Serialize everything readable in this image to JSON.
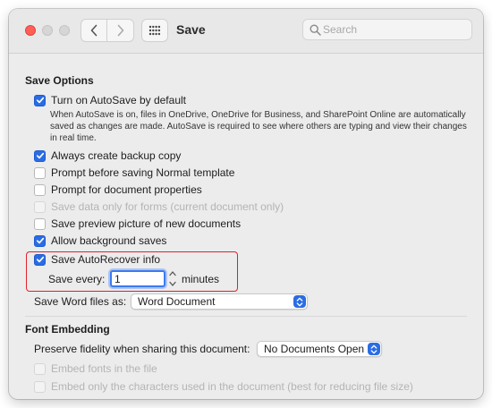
{
  "window": {
    "title": "Save",
    "search_placeholder": "Search"
  },
  "save_options": {
    "heading": "Save Options",
    "autosave": {
      "label": "Turn on AutoSave by default",
      "checked": true
    },
    "autosave_description": "When AutoSave is on, files in OneDrive, OneDrive for Business, and SharePoint Online are automatically saved as changes are made. AutoSave is required to see where others are typing and view their changes in real time.",
    "items": [
      {
        "label": "Always create backup copy",
        "checked": true,
        "disabled": false
      },
      {
        "label": "Prompt before saving Normal template",
        "checked": false,
        "disabled": false
      },
      {
        "label": "Prompt for document properties",
        "checked": false,
        "disabled": false
      },
      {
        "label": "Save data only for forms (current document only)",
        "checked": false,
        "disabled": true
      },
      {
        "label": "Save preview picture of new documents",
        "checked": false,
        "disabled": false
      },
      {
        "label": "Allow background saves",
        "checked": true,
        "disabled": false
      }
    ],
    "autorecover": {
      "label": "Save AutoRecover info",
      "checked": true
    },
    "save_every": {
      "label": "Save every:",
      "value": "1",
      "unit": "minutes"
    },
    "save_word_as": {
      "label": "Save Word files as:",
      "value": "Word Document"
    }
  },
  "font_embedding": {
    "heading": "Font Embedding",
    "preserve": {
      "label": "Preserve fidelity when sharing this document:",
      "value": "No Documents Open"
    },
    "items": [
      {
        "label": "Embed fonts in the file",
        "checked": false,
        "disabled": true
      },
      {
        "label": "Embed only the characters used in the document (best for reducing file size)",
        "checked": false,
        "disabled": true
      }
    ]
  },
  "colors": {
    "accent": "#2a6ce4",
    "highlight_border": "#e0212a"
  }
}
